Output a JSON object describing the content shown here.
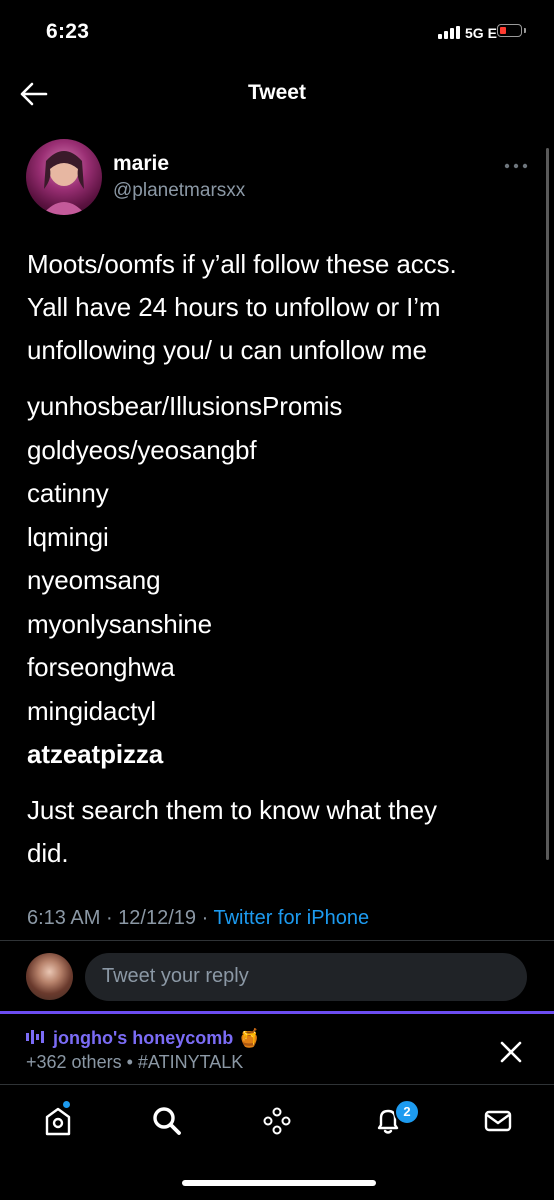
{
  "status_bar": {
    "time": "6:23",
    "network": "5G E"
  },
  "header": {
    "title": "Tweet"
  },
  "tweet": {
    "author_name": "marie",
    "author_handle": "@planetmarsxx",
    "text_lines": [
      "Moots/oomfs if y’all follow these accs.",
      "Yall have 24 hours to unfollow or I’m",
      "unfollowing you/ u can unfollow me"
    ],
    "accounts": [
      "yunhosbear/IllusionsPromis",
      "goldyeos/yeosangbf",
      "catinny",
      "lqmingi",
      "nyeomsang",
      "myonlysanshine",
      "forseonghwa",
      "mingidactyl",
      "atzeatpizza"
    ],
    "closing_lines": [
      "Just search them to know what they",
      "did."
    ],
    "time": "6:13 AM",
    "date": "12/12/19",
    "source": "Twitter for iPhone"
  },
  "reply": {
    "placeholder": "Tweet your reply"
  },
  "space": {
    "title": "jongho's honeycomb 🍯",
    "listeners": "+362 others",
    "tag": "#ATINYTALK"
  },
  "tabbar": {
    "notifications_badge": "2"
  },
  "colors": {
    "accent": "#1d9bf0",
    "spaces": "#7b6cf6",
    "muted": "#8b98a5",
    "battery_low": "#ff3b30"
  },
  "icons": [
    "back-arrow-icon",
    "more-icon",
    "close-icon",
    "home-icon",
    "search-icon",
    "spaces-icon",
    "bell-icon",
    "mail-icon"
  ]
}
